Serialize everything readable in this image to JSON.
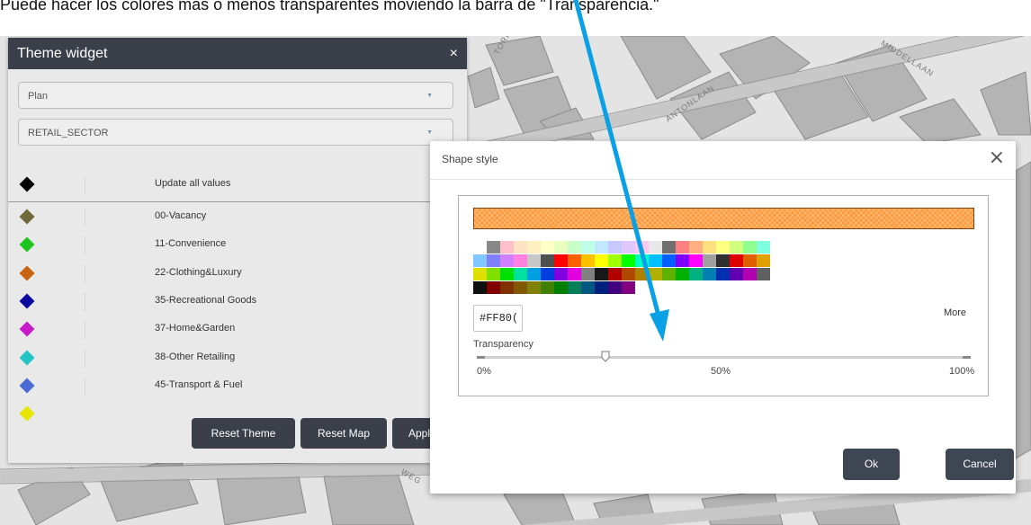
{
  "caption": "Puede hacer los colores más o menos transparentes moviendo la barra de \"Transparencia.\"",
  "map": {
    "streets": [
      "TORI",
      "MIDDELLAAN",
      "ANTONLAAN",
      "WEG"
    ]
  },
  "theme_widget": {
    "title": "Theme widget",
    "close_icon": "×",
    "select_layer": "Plan",
    "select_field": "RETAIL_SECTOR",
    "caret": "▼",
    "update_all": {
      "label": "Update all values",
      "color": "#000000"
    },
    "items": [
      {
        "label": "00-Vacancy",
        "color": "#6e6a3a"
      },
      {
        "label": "11-Convenience",
        "color": "#1fc41f"
      },
      {
        "label": "22-Clothing&Luxury",
        "color": "#c8640f"
      },
      {
        "label": "35-Recreational Goods",
        "color": "#0a0aa0"
      },
      {
        "label": "37-Home&Garden",
        "color": "#c81cc8"
      },
      {
        "label": "38-Other Retailing",
        "color": "#22c4c4"
      },
      {
        "label": "45-Transport & Fuel",
        "color": "#4a6ad6"
      }
    ],
    "buttons": {
      "reset_theme": "Reset Theme",
      "reset_map": "Reset Map",
      "apply": "Apply"
    }
  },
  "shape_style": {
    "title": "Shape style",
    "close_icon": "×",
    "preview_color": "#FF8000",
    "hex_value": "#FF80(",
    "more": "More",
    "transparency_label": "Transparency",
    "transparency_value": 0.26,
    "ticks": {
      "min": "0%",
      "mid": "50%",
      "max": "100%"
    },
    "ok": "Ok",
    "cancel": "Cancel",
    "palette": [
      [
        "#ffffff",
        "#888888",
        "#ffc0cb",
        "#ffe4c4",
        "#fff0c0",
        "#ffffc8",
        "#e8ffc0",
        "#c8ffc8",
        "#c0ffe8",
        "#c0e8ff",
        "#c8c8ff",
        "#e0c8ff",
        "#ffc8f0",
        "#e8e8e8",
        "#707070",
        "#ff8080",
        "#ffb080",
        "#ffe080",
        "#ffff80",
        "#d0ff80",
        "#90ff90",
        "#80ffe0"
      ],
      [
        "#80c8ff",
        "#8080ff",
        "#d080ff",
        "#ff80e0",
        "#c8c8c8",
        "#505050",
        "#ff0000",
        "#ff6000",
        "#ffc000",
        "#ffff00",
        "#a0ff00",
        "#00ff00",
        "#00ffc0",
        "#00c0ff",
        "#0060ff",
        "#8000ff",
        "#ff00ff",
        "#a0a0a0",
        "#303030",
        "#e00000",
        "#e06000",
        "#e0a000"
      ],
      [
        "#e0e000",
        "#80e000",
        "#00e000",
        "#00e0a0",
        "#00a0e0",
        "#0040e0",
        "#8000e0",
        "#e000e0",
        "#808080",
        "#181818",
        "#b00000",
        "#b04800",
        "#b08000",
        "#b0b000",
        "#60b000",
        "#00b000",
        "#00b080",
        "#0080b0",
        "#0030b0",
        "#6000b0",
        "#b000b0",
        "#606060"
      ],
      [
        "#101010",
        "#800000",
        "#803000",
        "#805800",
        "#808000",
        "#408000",
        "#008000",
        "#008058",
        "#005880",
        "#002080",
        "#400080",
        "#800080"
      ]
    ],
    "arrow_color": "#0aa0e6"
  }
}
